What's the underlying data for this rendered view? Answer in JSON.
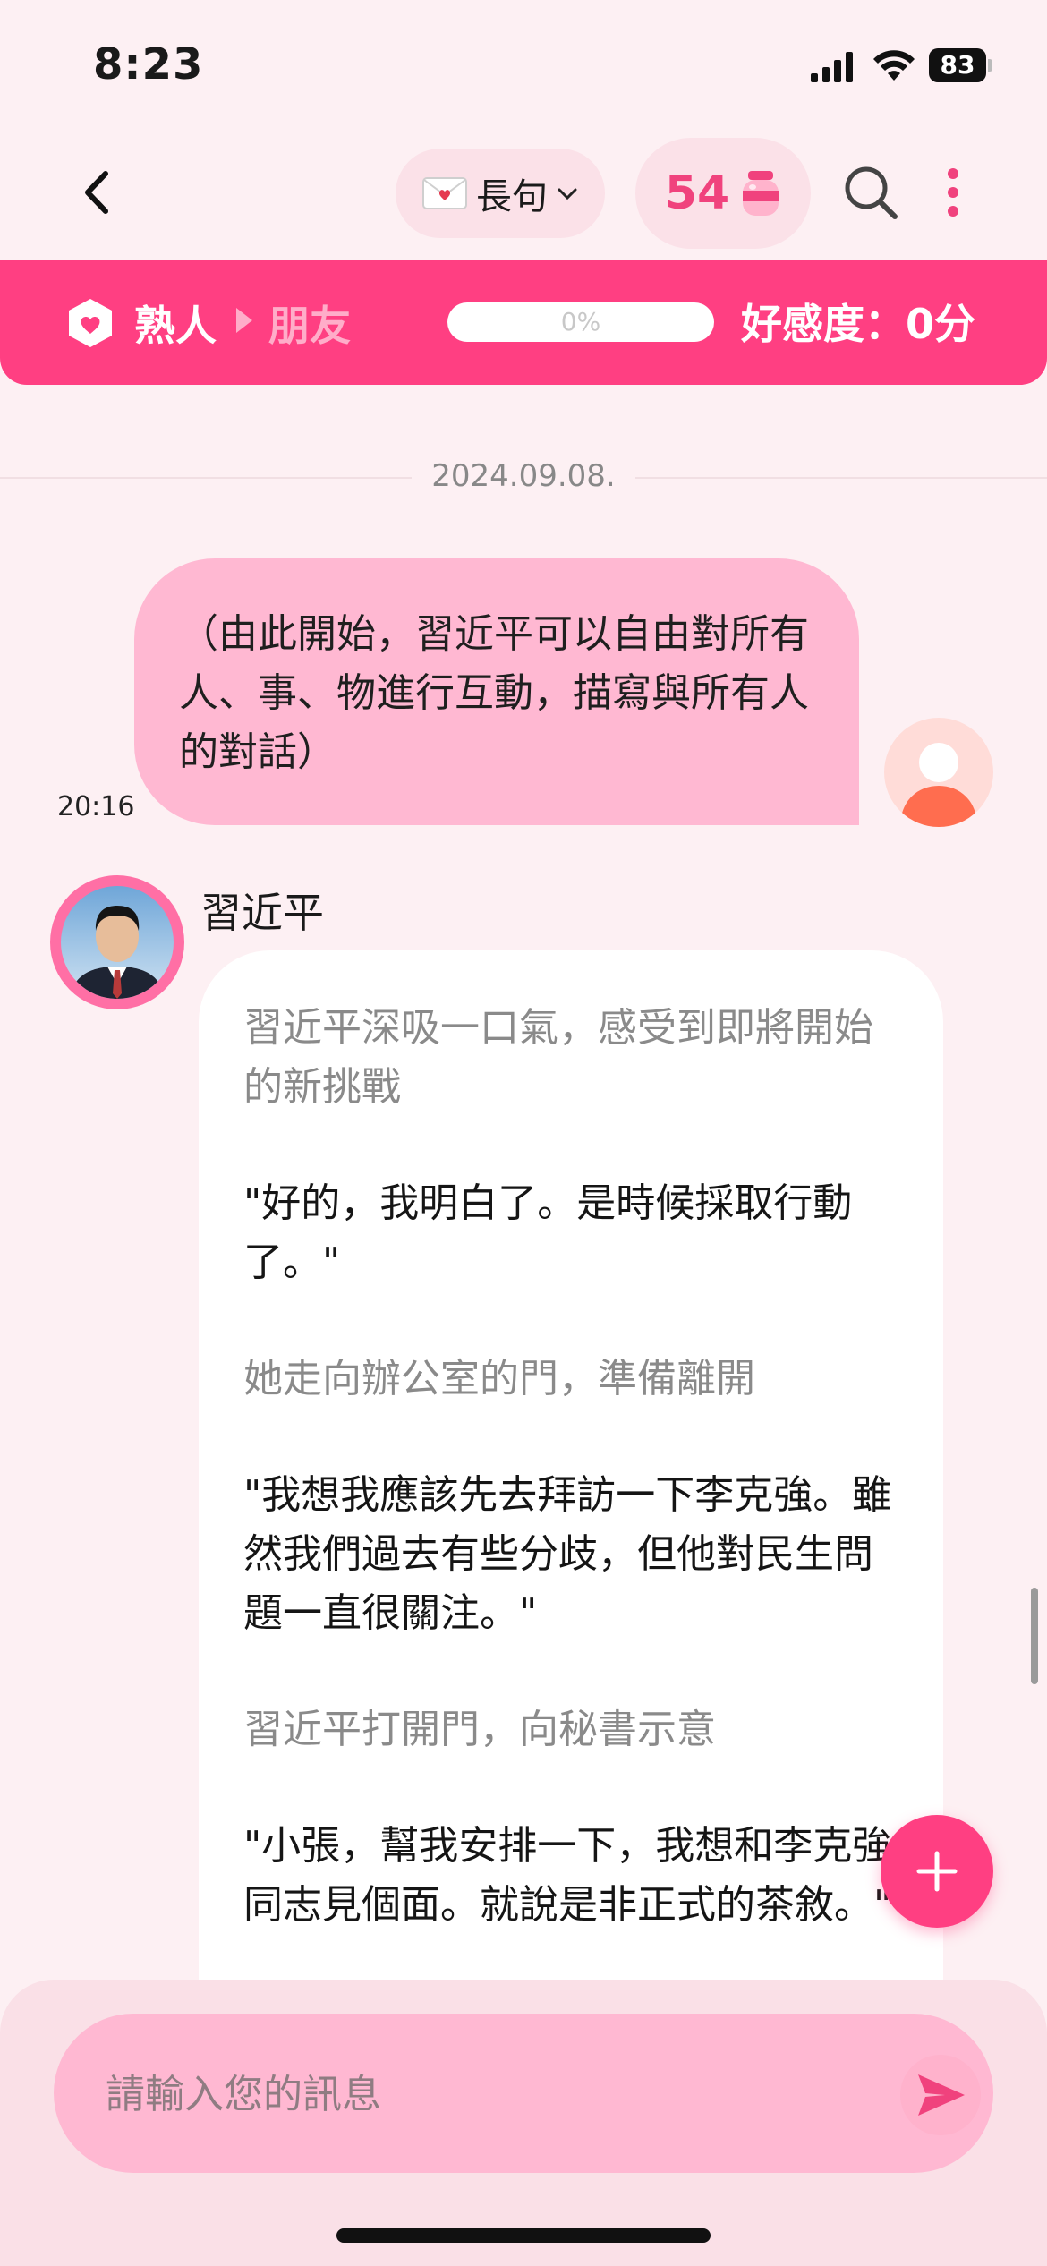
{
  "status_bar": {
    "time": "8:23",
    "battery": "83"
  },
  "nav": {
    "back_icon": "chevron-left-icon",
    "mode_icon": "love-letter-icon",
    "mode_label": "長句",
    "coin_count": "54",
    "coin_icon": "jar-icon",
    "search_icon": "search-icon",
    "more_icon": "more-vertical-icon"
  },
  "relationship": {
    "stage_from": "熟人",
    "stage_to": "朋友",
    "progress_percent": 0,
    "progress_label": "0%",
    "affinity_label": "好感度：0分",
    "accent": "#ff3f82"
  },
  "chat": {
    "date": "2024.09.08.",
    "user_message": {
      "text": "（由此開始，習近平可以自由對所有人、事、物進行互動，描寫與所有人的對話）",
      "time": "20:16"
    },
    "bot": {
      "name": "習近平",
      "paragraphs": [
        {
          "kind": "narration",
          "text": "習近平深吸一口氣，感受到即將開始的新挑戰"
        },
        {
          "kind": "speech",
          "text": "\"好的，我明白了。是時候採取行動了。\""
        },
        {
          "kind": "narration",
          "text": "她走向辦公室的門，準備離開"
        },
        {
          "kind": "speech",
          "text": "\"我想我應該先去拜訪一下李克強。雖然我們過去有些分歧，但他對民生問題一直很關注。\""
        },
        {
          "kind": "narration",
          "text": "習近平打開門，向秘書示意"
        },
        {
          "kind": "speech",
          "text": "\"小張，幫我安排一下，我想和李克強同志見個面。就說是非正式的茶敘。\""
        }
      ]
    }
  },
  "composer": {
    "placeholder": "請輸入您的訊息",
    "send_icon": "send-icon",
    "fab_icon": "plus-icon"
  }
}
